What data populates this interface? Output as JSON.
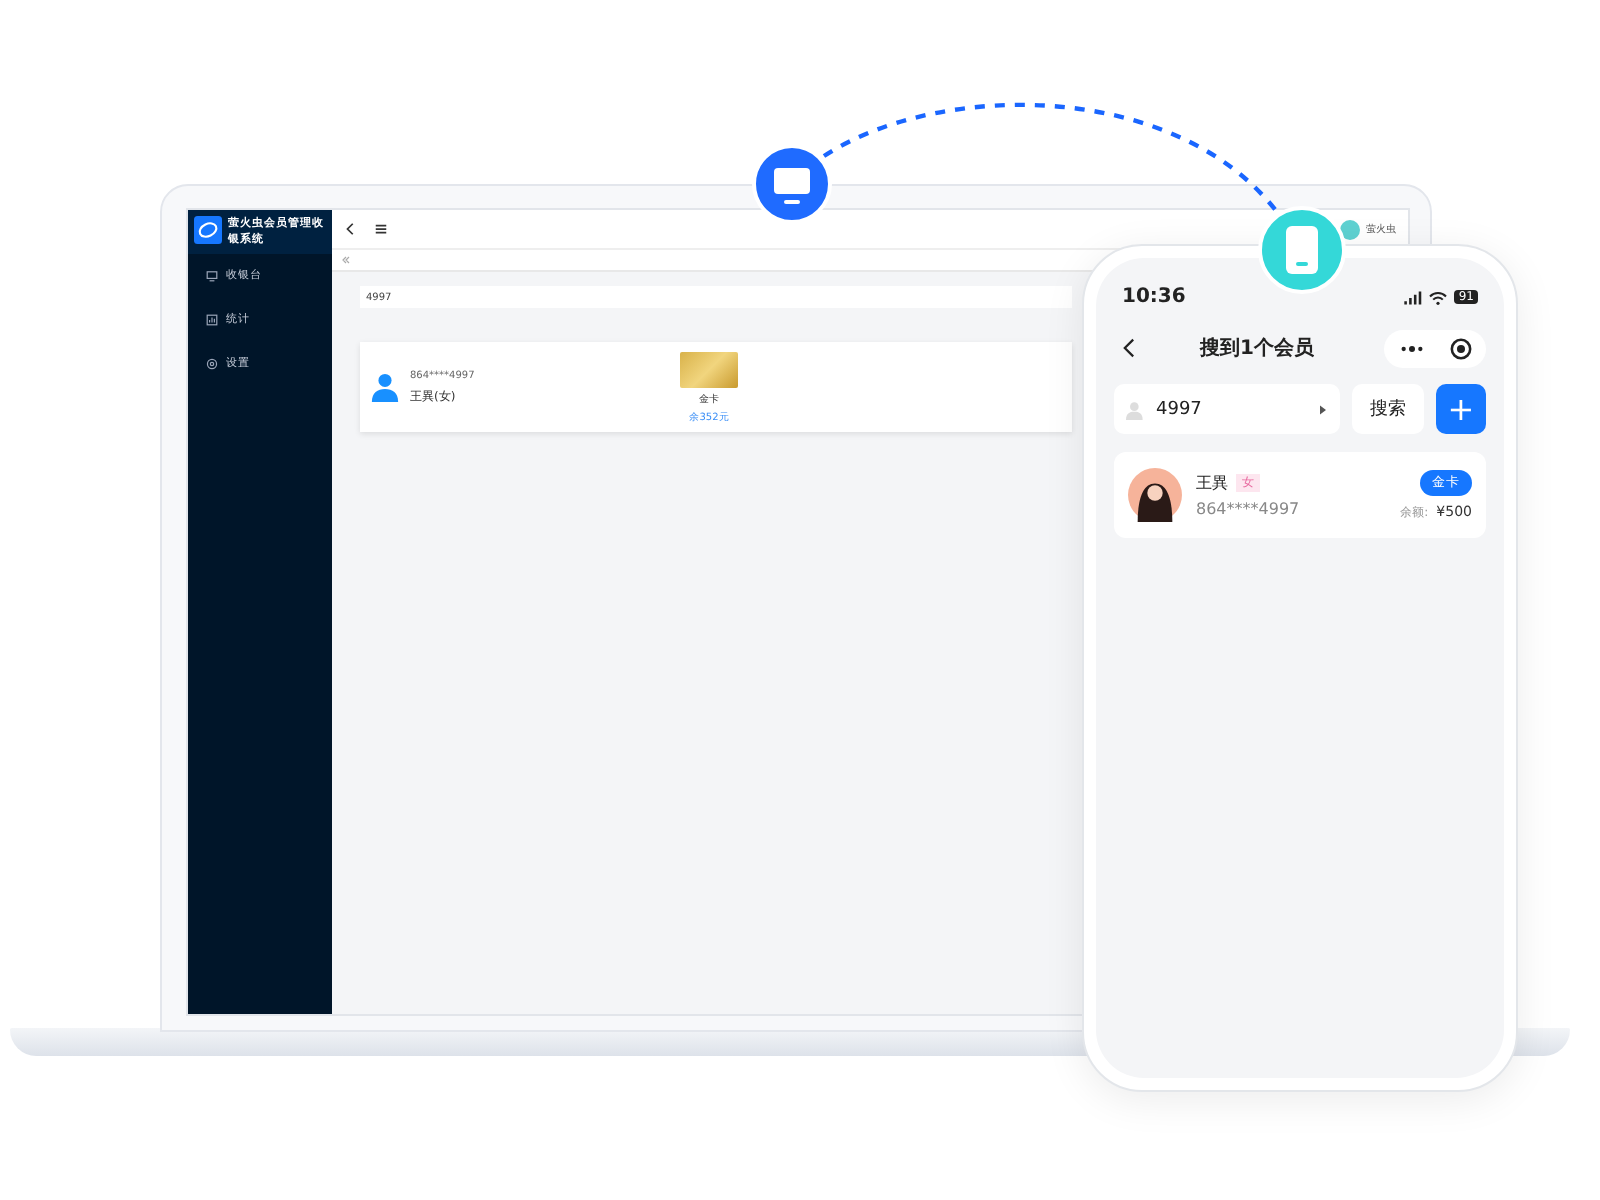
{
  "laptop": {
    "sidebar": {
      "title": "萤火虫会员管理收银系统",
      "items": [
        {
          "label": "收银台",
          "kind": "monitor"
        },
        {
          "label": "统计",
          "kind": "chart"
        },
        {
          "label": "设置",
          "kind": "gear"
        }
      ]
    },
    "user_name": "萤火虫",
    "search": {
      "value": "4997"
    },
    "member": {
      "phone": "864****4997",
      "name": "王異(女)",
      "card_name": "金卡",
      "balance": "余352元"
    }
  },
  "phone": {
    "time": "10:36",
    "battery": "91",
    "title": "搜到1个会员",
    "search": {
      "value": "4997"
    },
    "search_button": "搜索",
    "add_button": "+",
    "members": [
      {
        "name": "王異",
        "gender": "女",
        "phone": "864****4997",
        "card": "金卡",
        "balance_label": "余额:",
        "balance": "¥500"
      }
    ]
  }
}
